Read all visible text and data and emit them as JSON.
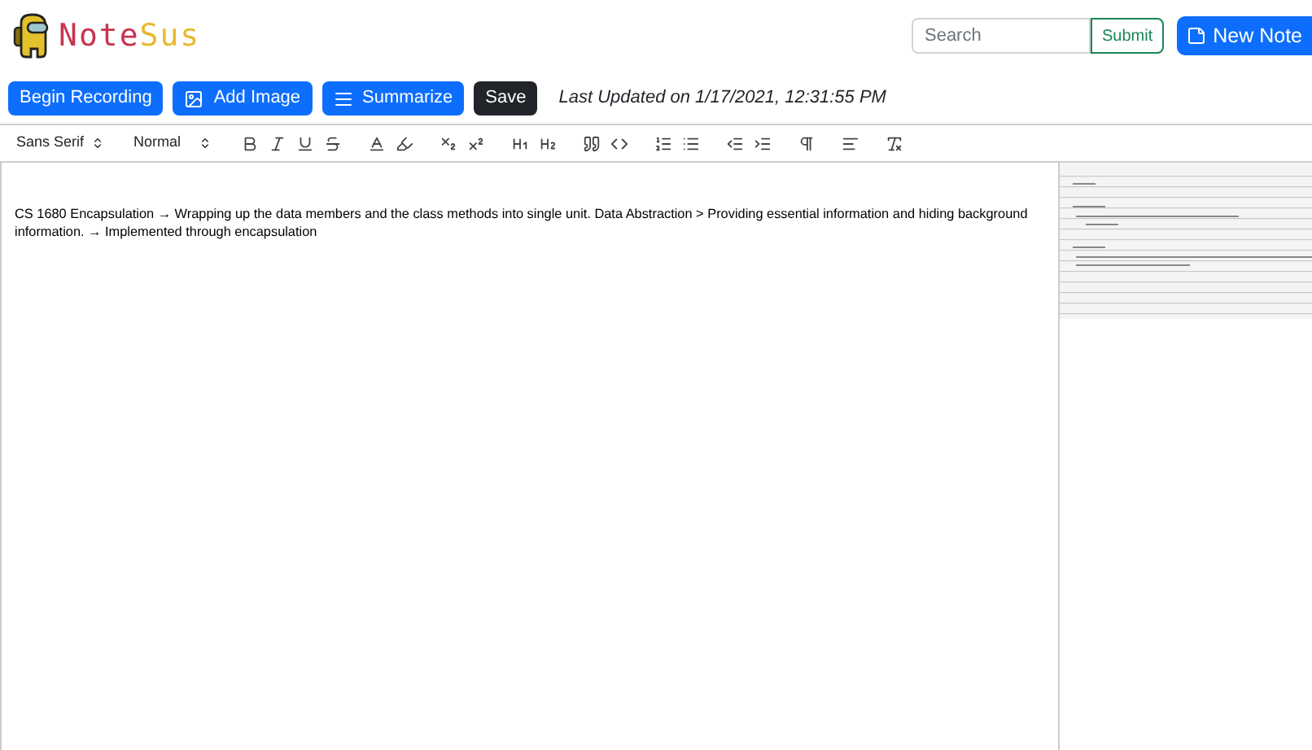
{
  "header": {
    "logo_text_first": "Note",
    "logo_text_second": "Sus",
    "search": {
      "placeholder": "Search"
    },
    "submit_button": "Submit",
    "new_note_button": "New Note"
  },
  "actions": {
    "buttons": [
      {
        "label": "Begin Recording",
        "kind": "primary"
      },
      {
        "label": "Add Image",
        "kind": "primary-image"
      },
      {
        "label": "Summarize",
        "kind": "primary-list"
      },
      {
        "label": "Save",
        "kind": "dark"
      }
    ],
    "last_updated": "Last Updated on 1/17/2021, 12:31:55 PM"
  },
  "toolbar": {
    "font": "Sans Serif",
    "size": "Normal"
  },
  "editor": {
    "text": "CS 1680 Encapsulation → Wrapping up the data members and the class methods into single unit. Data Abstraction > Providing essential information and hiding background information. → Implemented through encapsulation"
  }
}
